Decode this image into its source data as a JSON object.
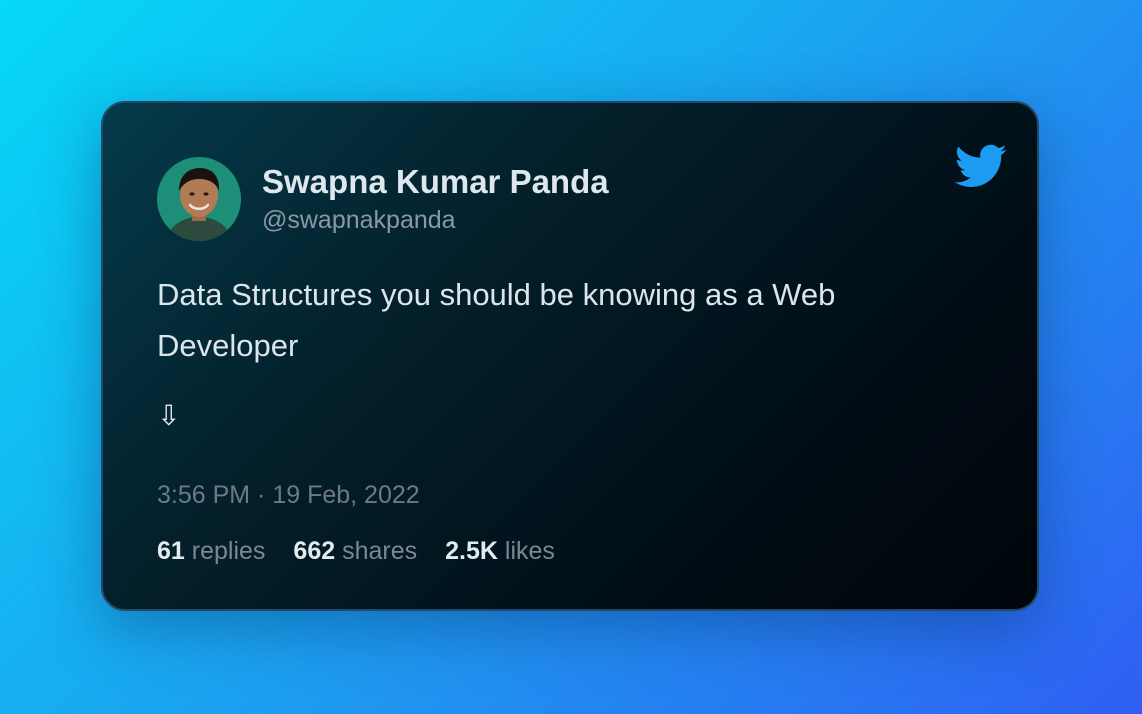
{
  "background": {
    "gradient_start": "#06d8f6",
    "gradient_end": "#2f5ff2"
  },
  "tweet": {
    "author_name": "Swapna Kumar Panda",
    "handle": "@swapnakpanda",
    "text": "Data Structures you should be knowing as a Web Developer",
    "arrow": "⇩",
    "timestamp": "3:56 PM · 19 Feb, 2022",
    "icons": {
      "brand": "twitter-bird-icon",
      "avatar": "profile-photo"
    },
    "colors": {
      "twitter_blue": "#1d9bf0",
      "avatar_bg": "#1d8e78"
    }
  },
  "stats": {
    "replies_count": "61",
    "replies_label": "replies",
    "shares_count": "662",
    "shares_label": "shares",
    "likes_count": "2.5K",
    "likes_label": "likes"
  }
}
